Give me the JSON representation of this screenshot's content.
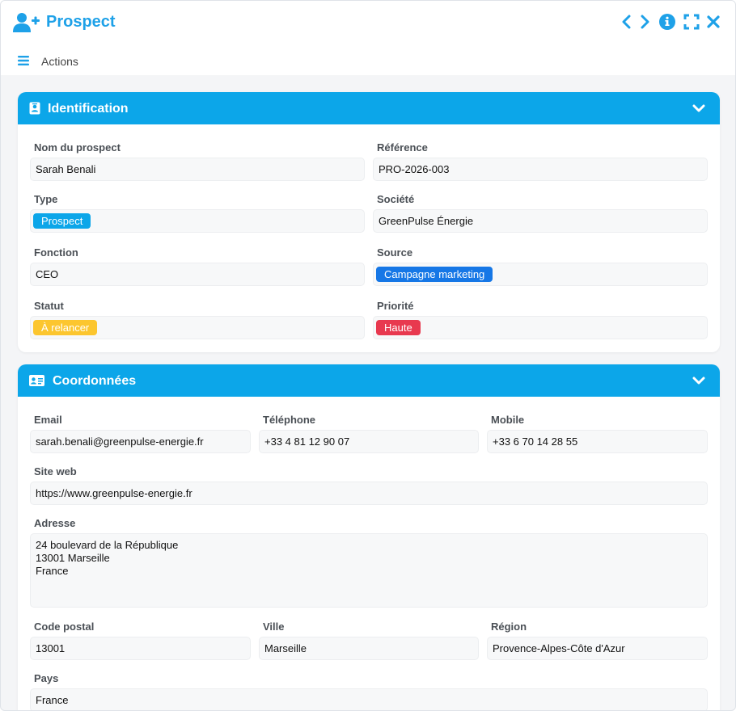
{
  "window": {
    "title": "Prospect",
    "icons": {
      "title": "user-plus-icon",
      "prev": "chevron-left-icon",
      "next": "chevron-right-icon",
      "info": "info-icon",
      "fullscreen": "expand-icon",
      "close": "close-icon"
    },
    "accent_color": "#1ea1e8"
  },
  "toolbar": {
    "actions_label": "Actions",
    "menu_icon": "hamburger-icon"
  },
  "identification": {
    "title": "Identification",
    "icon": "id-badge-icon",
    "header_color": "#0ca6e9",
    "nom_label": "Nom du prospect",
    "nom_value": "Sarah Benali",
    "reference_label": "Référence",
    "reference_value": "PRO-2026-003",
    "type_label": "Type",
    "type_value": "Prospect",
    "type_color": "#0ca6e9",
    "societe_label": "Société",
    "societe_value": "GreenPulse Énergie",
    "fonction_label": "Fonction",
    "fonction_value": "CEO",
    "source_label": "Source",
    "source_value": "Campagne marketing",
    "source_color": "#1677e6",
    "statut_label": "Statut",
    "statut_value": "À relancer",
    "statut_color": "#fcc62f",
    "priorite_label": "Priorité",
    "priorite_value": "Haute",
    "priorite_color": "#e8394f"
  },
  "coordonnees": {
    "title": "Coordonnées",
    "icon": "address-card-icon",
    "email_label": "Email",
    "email_value": "sarah.benali@greenpulse-energie.fr",
    "telephone_label": "Téléphone",
    "telephone_value": "+33 4 81 12 90 07",
    "mobile_label": "Mobile",
    "mobile_value": "+33 6 70 14 28 55",
    "site_label": "Site web",
    "site_value": "https://www.greenpulse-energie.fr",
    "adresse_label": "Adresse",
    "adresse_value": "24 boulevard de la République\n13001 Marseille\nFrance",
    "cp_label": "Code postal",
    "cp_value": "13001",
    "ville_label": "Ville",
    "ville_value": "Marseille",
    "region_label": "Région",
    "region_value": "Provence-Alpes-Côte d'Azur",
    "pays_label": "Pays",
    "pays_value": "France"
  }
}
